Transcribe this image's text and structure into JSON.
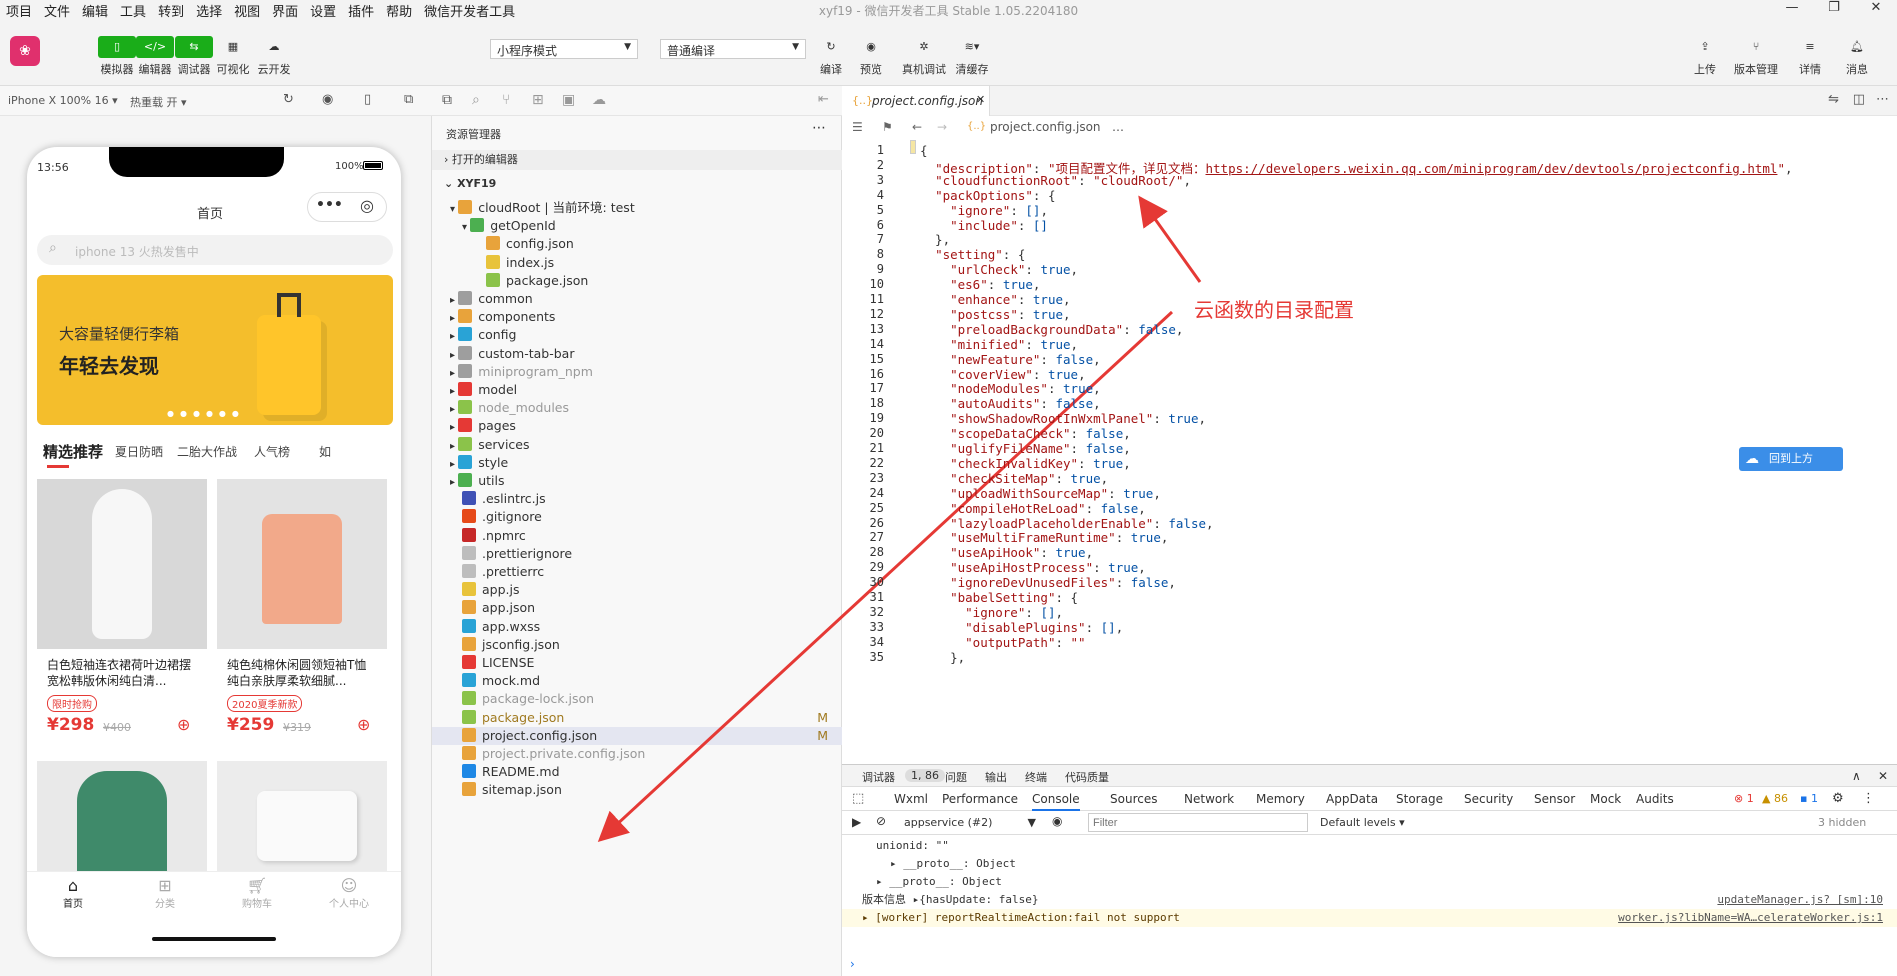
{
  "menu": [
    "项目",
    "文件",
    "编辑",
    "工具",
    "转到",
    "选择",
    "视图",
    "界面",
    "设置",
    "插件",
    "帮助",
    "微信开发者工具"
  ],
  "window_title": "xyf19 - 微信开发者工具 Stable 1.05.2204180",
  "toolbar": {
    "simulator": "模拟器",
    "editor": "编辑器",
    "debugger": "调试器",
    "visual": "可视化",
    "cloud": "云开发",
    "mode": "小程序模式",
    "compile_mode": "普通编译",
    "compile": "编译",
    "preview": "预览",
    "real_debug": "真机调试",
    "clear_cache": "清缓存",
    "upload": "上传",
    "version": "版本管理",
    "details": "详情",
    "messages": "消息"
  },
  "simbar": {
    "device": "iPhone X 100% 16 ▾",
    "hotreload": "热重载 开 ▾"
  },
  "phone": {
    "time": "13:56",
    "battery": "100%",
    "title": "首页",
    "search_placeholder": "iphone 13 火热发售中",
    "banner_line1": "大容量轻便行李箱",
    "banner_line2": "年轻去发现",
    "tabs": [
      "精选推荐",
      "夏日防晒",
      "二胎大作战",
      "人气榜",
      "如"
    ],
    "products": [
      {
        "name": "白色短袖连衣裙荷叶边裙摆宽松韩版休闲纯白清...",
        "badge": "限时抢购",
        "price": "¥298",
        "old": "¥400"
      },
      {
        "name": "纯色纯棉休闲圆领短袖T恤纯白亲肤厚柔软细腻...",
        "badge": "2020夏季新款",
        "price": "¥259",
        "old": "¥319"
      }
    ],
    "nav": [
      "首页",
      "分类",
      "购物车",
      "个人中心"
    ]
  },
  "explorer": {
    "title": "资源管理器",
    "open_editors": "打开的编辑器",
    "project": "XYF19",
    "items": [
      {
        "label": "cloudRoot | 当前环境: test",
        "depth": 1,
        "kind": "folder-open",
        "color": "#e8a33b"
      },
      {
        "label": "getOpenId",
        "depth": 2,
        "kind": "folder-open",
        "color": "#4caf50"
      },
      {
        "label": "config.json",
        "depth": 3,
        "kind": "json",
        "color": "#e8a33b"
      },
      {
        "label": "index.js",
        "depth": 3,
        "kind": "js",
        "color": "#e8c33b"
      },
      {
        "label": "package.json",
        "depth": 3,
        "kind": "pkg",
        "color": "#8bc34a"
      },
      {
        "label": "common",
        "depth": 1,
        "kind": "folder",
        "color": "#9e9e9e"
      },
      {
        "label": "components",
        "depth": 1,
        "kind": "folder",
        "color": "#e8a33b"
      },
      {
        "label": "config",
        "depth": 1,
        "kind": "folder",
        "color": "#29a3d6"
      },
      {
        "label": "custom-tab-bar",
        "depth": 1,
        "kind": "folder",
        "color": "#9e9e9e"
      },
      {
        "label": "miniprogram_npm",
        "depth": 1,
        "kind": "folder",
        "color": "#9e9e9e",
        "dim": true
      },
      {
        "label": "model",
        "depth": 1,
        "kind": "folder",
        "color": "#e53935"
      },
      {
        "label": "node_modules",
        "depth": 1,
        "kind": "folder",
        "color": "#8bc34a",
        "dim": true
      },
      {
        "label": "pages",
        "depth": 1,
        "kind": "folder",
        "color": "#e53935"
      },
      {
        "label": "services",
        "depth": 1,
        "kind": "folder",
        "color": "#8bc34a"
      },
      {
        "label": "style",
        "depth": 1,
        "kind": "folder",
        "color": "#29a3d6"
      },
      {
        "label": "utils",
        "depth": 1,
        "kind": "folder",
        "color": "#4caf50"
      },
      {
        "label": ".eslintrc.js",
        "depth": 1,
        "kind": "file",
        "color": "#3f51b5"
      },
      {
        "label": ".gitignore",
        "depth": 1,
        "kind": "file",
        "color": "#e64a19"
      },
      {
        "label": ".npmrc",
        "depth": 1,
        "kind": "file",
        "color": "#c62828"
      },
      {
        "label": ".prettierignore",
        "depth": 1,
        "kind": "file",
        "color": "#bdbdbd"
      },
      {
        "label": ".prettierrc",
        "depth": 1,
        "kind": "file",
        "color": "#bdbdbd"
      },
      {
        "label": "app.js",
        "depth": 1,
        "kind": "file",
        "color": "#e8c33b"
      },
      {
        "label": "app.json",
        "depth": 1,
        "kind": "file",
        "color": "#e8a33b"
      },
      {
        "label": "app.wxss",
        "depth": 1,
        "kind": "file",
        "color": "#29a3d6"
      },
      {
        "label": "jsconfig.json",
        "depth": 1,
        "kind": "file",
        "color": "#e8a33b"
      },
      {
        "label": "LICENSE",
        "depth": 1,
        "kind": "file",
        "color": "#e53935"
      },
      {
        "label": "mock.md",
        "depth": 1,
        "kind": "file",
        "color": "#29a3d6"
      },
      {
        "label": "package-lock.json",
        "depth": 1,
        "kind": "file",
        "color": "#8bc34a",
        "dim": true
      },
      {
        "label": "package.json",
        "depth": 1,
        "kind": "file",
        "color": "#8bc34a",
        "status": "M",
        "status_color": "#a07a20"
      },
      {
        "label": "project.config.json",
        "depth": 1,
        "kind": "file",
        "color": "#e8a33b",
        "status": "M",
        "selected": true
      },
      {
        "label": "project.private.config.json",
        "depth": 1,
        "kind": "file",
        "color": "#e8a33b",
        "dim": true
      },
      {
        "label": "README.md",
        "depth": 1,
        "kind": "file",
        "color": "#1e88e5"
      },
      {
        "label": "sitemap.json",
        "depth": 1,
        "kind": "file",
        "color": "#e8a33b"
      }
    ]
  },
  "editor": {
    "tab": "project.config.json",
    "breadcrumb": "project.config.json",
    "breadcrumb_more": "…",
    "lines": [
      "{",
      "  \"description\": \"项目配置文件，详见文档：https://developers.weixin.qq.com/miniprogram/dev/devtools/projectconfig.html\",",
      "  \"cloudfunctionRoot\": \"cloudRoot/\",",
      "  \"packOptions\": {",
      "    \"ignore\": [],",
      "    \"include\": []",
      "  },",
      "  \"setting\": {",
      "    \"urlCheck\": true,",
      "    \"es6\": true,",
      "    \"enhance\": true,",
      "    \"postcss\": true,",
      "    \"preloadBackgroundData\": false,",
      "    \"minified\": true,",
      "    \"newFeature\": false,",
      "    \"coverView\": true,",
      "    \"nodeModules\": true,",
      "    \"autoAudits\": false,",
      "    \"showShadowRootInWxmlPanel\": true,",
      "    \"scopeDataCheck\": false,",
      "    \"uglifyFileName\": false,",
      "    \"checkInvalidKey\": true,",
      "    \"checkSiteMap\": true,",
      "    \"uploadWithSourceMap\": true,",
      "    \"compileHotReLoad\": false,",
      "    \"lazyloadPlaceholderEnable\": false,",
      "    \"useMultiFrameRuntime\": true,",
      "    \"useApiHook\": true,",
      "    \"useApiHostProcess\": true,",
      "    \"ignoreDevUnusedFiles\": false,",
      "    \"babelSetting\": {",
      "      \"ignore\": [],",
      "      \"disablePlugins\": [],",
      "      \"outputPath\": \"\"",
      "    },"
    ],
    "annotation": "云函数的目录配置",
    "floating_btn": "回到上方"
  },
  "devtools": {
    "tabs_top": [
      "调试器",
      "1, 86",
      "问题",
      "输出",
      "终端",
      "代码质量"
    ],
    "tabs": [
      "Wxml",
      "Performance",
      "Console",
      "Sources",
      "Network",
      "Memory",
      "AppData",
      "Storage",
      "Security",
      "Sensor",
      "Mock",
      "Audits"
    ],
    "counts": {
      "errors": "1",
      "warnings": "86",
      "info": "1"
    },
    "context": "appservice (#2)",
    "filter_placeholder": "Filter",
    "levels": "Default levels ▾",
    "hidden": "3 hidden",
    "console": [
      {
        "text": "unionid: \"\"",
        "indent": 1
      },
      {
        "text": "▸ __proto__: Object",
        "indent": 2
      },
      {
        "text": "▸ __proto__: Object",
        "indent": 1
      },
      {
        "text": "版本信息 ▸{hasUpdate: false}",
        "indent": 0,
        "src": "updateManager.js? [sm]:10"
      },
      {
        "text": "▸ [worker] reportRealtimeAction:fail not support",
        "indent": 0,
        "src": "worker.js?libName=WA…celerateWorker.js:1",
        "warn": true
      }
    ]
  }
}
